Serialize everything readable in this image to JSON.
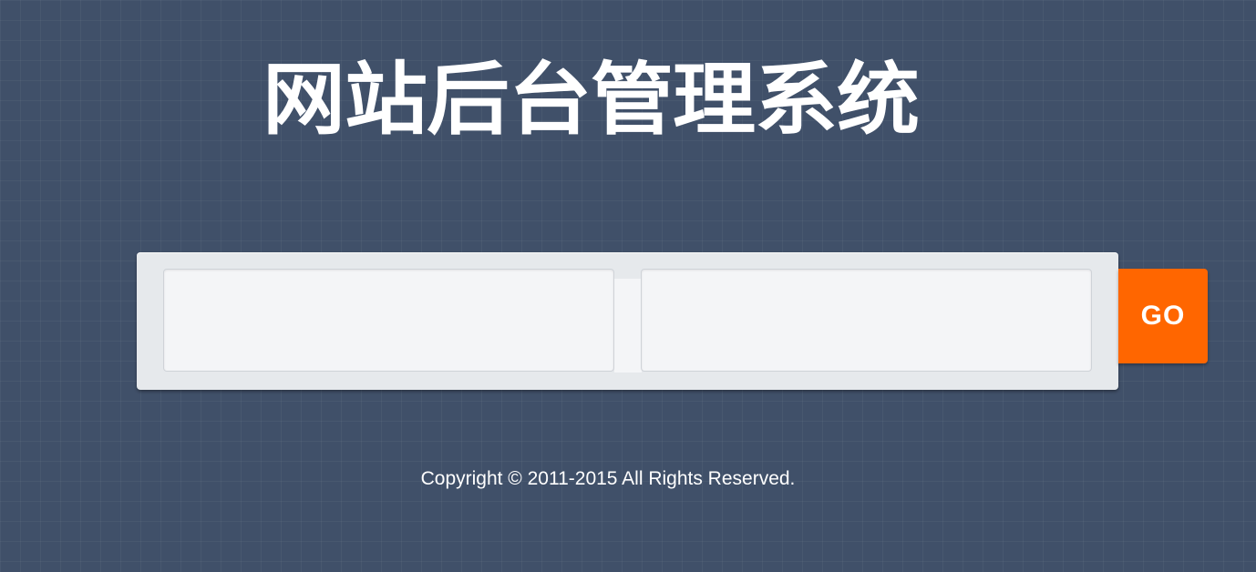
{
  "header": {
    "title": "网站后台管理系统"
  },
  "login_form": {
    "username": {
      "value": "",
      "placeholder": ""
    },
    "password": {
      "value": "",
      "placeholder": ""
    },
    "submit_label": "GO"
  },
  "footer": {
    "copyright": "Copyright © 2011-2015 All Rights Reserved."
  },
  "colors": {
    "background": "#405069",
    "panel": "#e6e9ec",
    "field": "#f4f5f7",
    "accent": "#ff6600",
    "text_light": "#ffffff"
  }
}
